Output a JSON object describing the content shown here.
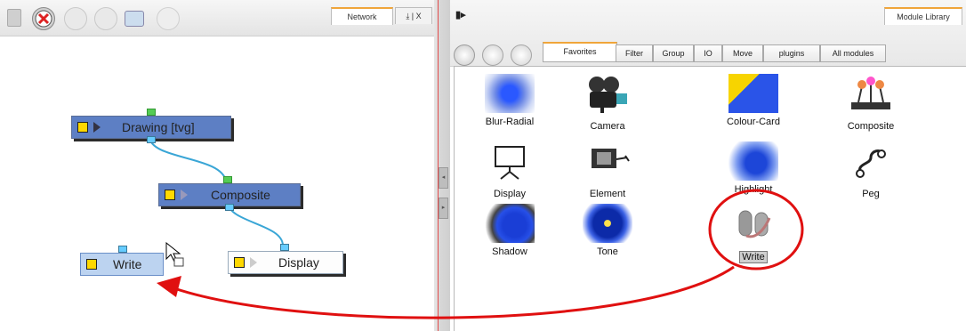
{
  "network": {
    "tab_label": "Network",
    "tab_extra": "⤓ | X",
    "toolbar_icons": [
      "clipboard-icon",
      "delete-icon",
      "check-icon",
      "cancel-icon",
      "monitor-icon",
      "print-icon"
    ],
    "nodes": {
      "drawing": "Drawing [tvg]",
      "composite": "Composite",
      "display": "Display",
      "write": "Write"
    }
  },
  "library": {
    "collapse_label": "▮▸",
    "tab_label": "Module Library",
    "subtabs": [
      "Favorites",
      "Filter",
      "Group",
      "IO",
      "Move",
      "plugins",
      "All modules"
    ],
    "modules": [
      {
        "label": "Blur-Radial"
      },
      {
        "label": "Camera"
      },
      {
        "label": "Colour-Card"
      },
      {
        "label": "Composite"
      },
      {
        "label": "Display"
      },
      {
        "label": "Element"
      },
      {
        "label": "Highlight"
      },
      {
        "label": "Peg"
      },
      {
        "label": "Shadow"
      },
      {
        "label": "Tone"
      },
      {
        "label": "Write"
      }
    ]
  },
  "colors": {
    "annotation": "#e01010",
    "node_fill": "#5d7fc4",
    "tab_accent": "#f0a53a"
  }
}
